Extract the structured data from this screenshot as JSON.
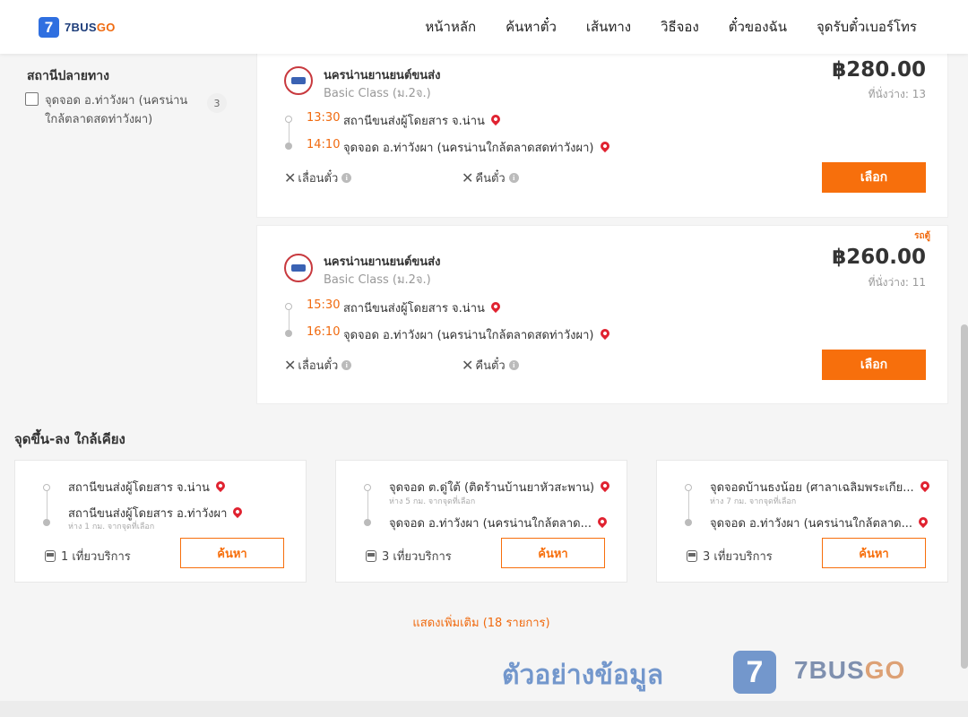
{
  "header": {
    "logo_mark": "7",
    "logo_text_a": "7BUS",
    "logo_text_b": "GO",
    "nav": [
      "หน้าหลัก",
      "ค้นหาตั๋ว",
      "เส้นทาง",
      "วิธีจอง",
      "ตั๋วของฉัน",
      "จุดรับตั๋วเบอร์โทร"
    ]
  },
  "sidebar": {
    "title": "สถานีปลายทาง",
    "filter": {
      "label": "จุดจอด อ.ท่าวังผา (นครน่านใกล้ตลาดสดท่าวังผา)",
      "count": "3",
      "checked": false
    }
  },
  "results": [
    {
      "operator": "นครน่านยานยนต์ขนส่ง",
      "class": "Basic Class (ม.2จ.)",
      "price": "฿280.00",
      "seats": "ที่นั่งว่าง: 13",
      "tag": "",
      "depart_time": "13:30",
      "depart_stop": "สถานีขนส่งผู้โดยสาร จ.น่าน",
      "arrive_time": "14:10",
      "arrive_stop": "จุดจอด อ.ท่าวังผา (นครน่านใกล้ตลาดสดท่าวังผา)",
      "policy_postpone": "เลื่อนตั๋ว",
      "policy_refund": "คืนตั๋ว",
      "select_label": "เลือก"
    },
    {
      "operator": "นครน่านยานยนต์ขนส่ง",
      "class": "Basic Class (ม.2จ.)",
      "price": "฿260.00",
      "seats": "ที่นั่งว่าง: 11",
      "tag": "รถตู้",
      "depart_time": "15:30",
      "depart_stop": "สถานีขนส่งผู้โดยสาร จ.น่าน",
      "arrive_time": "16:10",
      "arrive_stop": "จุดจอด อ.ท่าวังผา (นครน่านใกล้ตลาดสดท่าวังผา)",
      "policy_postpone": "เลื่อนตั๋ว",
      "policy_refund": "คืนตั๋ว",
      "select_label": "เลือก"
    }
  ],
  "nearby": {
    "title": "จุดขึ้น-ลง ใกล้เคียง",
    "cards": [
      {
        "from": "สถานีขนส่งผู้โดยสาร จ.น่าน",
        "from_dist": "",
        "to": "สถานีขนส่งผู้โดยสาร อ.ท่าวังผา",
        "to_dist": "ห่าง 1 กม. จากจุดที่เลือก",
        "trips": "1 เที่ยวบริการ",
        "search_label": "ค้นหา"
      },
      {
        "from": "จุดจอด ต.ดู่ใต้ (ติดร้านบ้านยาหัวสะพาน)",
        "from_dist": "ห่าง 5 กม. จากจุดที่เลือก",
        "to": "จุดจอด อ.ท่าวังผา (นครน่านใกล้ตลาด...",
        "to_dist": "",
        "trips": "3 เที่ยวบริการ",
        "search_label": "ค้นหา"
      },
      {
        "from": "จุดจอดบ้านธงน้อย (ศาลาเฉลิมพระเกีย...",
        "from_dist": "ห่าง 7 กม. จากจุดที่เลือก",
        "to": "จุดจอด อ.ท่าวังผา (นครน่านใกล้ตลาด...",
        "to_dist": "",
        "trips": "3 เที่ยวบริการ",
        "search_label": "ค้นหา"
      }
    ],
    "show_more": "แสดงเพิ่มเติม (18 รายการ)"
  },
  "watermark": {
    "text": "ตัวอย่างข้อมูล",
    "logo_mark": "7",
    "brand_a": "7BUS",
    "brand_b": "GO"
  },
  "colors": {
    "accent": "#f76f0c",
    "brand_blue": "#2f6fe0",
    "pin": "#e02230"
  }
}
